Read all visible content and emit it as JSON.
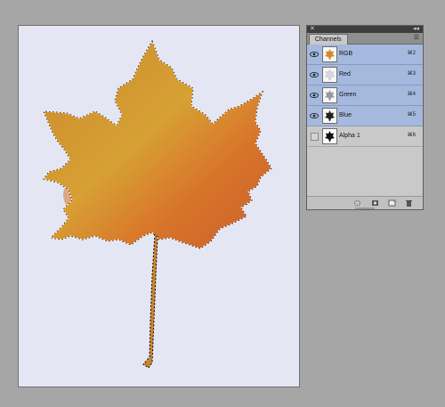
{
  "panel": {
    "title": "Channels",
    "channels": [
      {
        "name": "RGB",
        "shortcut": "⌘2",
        "visible": true,
        "selected": true,
        "thumb_color": "#d58a2a"
      },
      {
        "name": "Red",
        "shortcut": "⌘3",
        "visible": true,
        "selected": true,
        "thumb_color": "#d8d8d8"
      },
      {
        "name": "Green",
        "shortcut": "⌘4",
        "visible": true,
        "selected": true,
        "thumb_color": "#9a9a9a"
      },
      {
        "name": "Blue",
        "shortcut": "⌘5",
        "visible": true,
        "selected": true,
        "thumb_color": "#222222"
      },
      {
        "name": "Alpha 1",
        "shortcut": "⌘6",
        "visible": false,
        "selected": false,
        "thumb_color": "#111111"
      }
    ],
    "footer_icons": [
      "load-selection-icon",
      "save-selection-icon",
      "new-channel-icon",
      "delete-channel-icon"
    ]
  },
  "colors": {
    "background": "#a6a6a6",
    "canvas": "#e4e6f4",
    "selection_highlight": "#a5b9de",
    "leaf_orange": "#d8742a",
    "leaf_yellow": "#c9a22c",
    "leaf_green": "#8e9a33"
  }
}
